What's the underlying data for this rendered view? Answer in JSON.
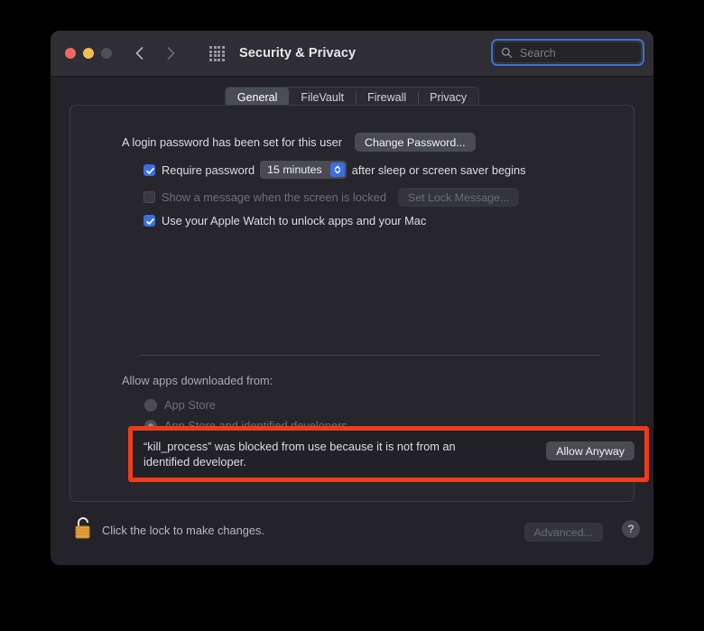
{
  "window": {
    "title": "Security & Privacy",
    "traffic_lights": {
      "close": "close-button",
      "minimize": "minimize-button",
      "zoom": "zoom-button"
    },
    "nav": {
      "back": "back-arrow",
      "forward": "forward-arrow",
      "show_all": "show-all-grid"
    }
  },
  "search": {
    "placeholder": "Search",
    "value": "",
    "icon": "search-icon"
  },
  "tabs": [
    {
      "label": "General",
      "selected": true
    },
    {
      "label": "FileVault",
      "selected": false
    },
    {
      "label": "Firewall",
      "selected": false
    },
    {
      "label": "Privacy",
      "selected": false
    }
  ],
  "general": {
    "login_password_text": "A login password has been set for this user",
    "change_password_label": "Change Password...",
    "require_password": {
      "label": "Require password",
      "checked": true,
      "delay_value": "15 minutes",
      "suffix": "after sleep or screen saver begins"
    },
    "show_message": {
      "label": "Show a message when the screen is locked",
      "checked": false,
      "enabled": false,
      "button_label": "Set Lock Message..."
    },
    "apple_watch": {
      "label": "Use your Apple Watch to unlock apps and your Mac",
      "checked": true
    }
  },
  "allow_apps": {
    "heading": "Allow apps downloaded from:",
    "options": [
      {
        "label": "App Store",
        "selected": false
      },
      {
        "label": "App Store and identified developers",
        "selected": true
      }
    ]
  },
  "alert": {
    "message": "“kill_process” was blocked from use because it is not from an identified developer.",
    "button_label": "Allow Anyway",
    "highlight_color": "#ee3c17"
  },
  "footer": {
    "lock_icon": "padlock-unlocked-icon",
    "lock_caption": "Click the lock to make changes.",
    "advanced_label": "Advanced...",
    "help_label": "?"
  },
  "colors": {
    "accent_blue": "#3a6fe0",
    "window_body": "#232329",
    "titlebar": "#2e2e34",
    "panel": "#26262c",
    "alert_red": "#ee3c17",
    "lock_gold": "#e8a33d"
  }
}
